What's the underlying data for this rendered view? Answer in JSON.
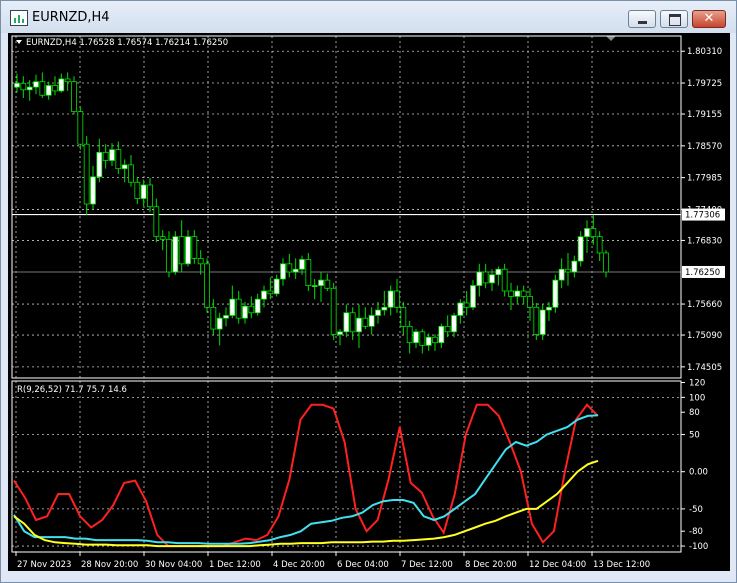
{
  "window": {
    "title": "EURNZD,H4",
    "icon": "chart-window-icon",
    "buttons": {
      "minimize": "minimize-icon",
      "maximize": "maximize-icon",
      "close": "close-icon"
    }
  },
  "chart_info": "EURNZD,H4  1.76528 1.76574 1.76214 1.76250",
  "colors": {
    "background": "#000000",
    "grid": "#c8c8c8",
    "bull_candle": "#ffffff",
    "bear_candle": "#000000",
    "candle_wick": "#00e000",
    "price_line": "#c0c0c0",
    "indicator_red": "#ff2020",
    "indicator_cyan": "#40e0f0",
    "indicator_yellow": "#ffff20"
  },
  "chart_data": [
    {
      "type": "candlestick",
      "title": "EURNZD,H4",
      "ohlc_readout": {
        "open": 1.76528,
        "high": 1.76574,
        "low": 1.76214,
        "close": 1.7625
      },
      "ylim": [
        1.743,
        1.8059
      ],
      "y_ticks": [
        "1.80310",
        "1.79725",
        "1.79155",
        "1.78570",
        "1.77985",
        "1.77400",
        "1.76830",
        "1.75660",
        "1.75090",
        "1.74505"
      ],
      "highlight_labels": [
        "1.77306",
        "1.76250"
      ],
      "horizontal_lines": [
        {
          "label": "1.77306",
          "value": 1.77306,
          "color": "#ffffff"
        },
        {
          "label": "1.76250",
          "value": 1.7625,
          "color": "#a0a0a0"
        }
      ],
      "candles": [
        [
          1.7965,
          1.799,
          1.7955,
          1.7972
        ],
        [
          1.7972,
          1.7985,
          1.7945,
          1.796
        ],
        [
          1.796,
          1.7978,
          1.794,
          1.7965
        ],
        [
          1.7965,
          1.7988,
          1.7952,
          1.7975
        ],
        [
          1.7975,
          1.7992,
          1.7945,
          1.795
        ],
        [
          1.795,
          1.7975,
          1.7942,
          1.7968
        ],
        [
          1.7968,
          1.7985,
          1.795,
          1.7958
        ],
        [
          1.7958,
          1.799,
          1.7955,
          1.798
        ],
        [
          1.798,
          1.7992,
          1.7958,
          1.7975
        ],
        [
          1.7975,
          1.7985,
          1.7915,
          1.792
        ],
        [
          1.792,
          1.793,
          1.785,
          1.786
        ],
        [
          1.786,
          1.7875,
          1.773,
          1.775
        ],
        [
          1.775,
          1.782,
          1.774,
          1.78
        ],
        [
          1.78,
          1.787,
          1.779,
          1.7845
        ],
        [
          1.7845,
          1.786,
          1.7815,
          1.783
        ],
        [
          1.783,
          1.7862,
          1.782,
          1.785
        ],
        [
          1.785,
          1.7865,
          1.7805,
          1.7815
        ],
        [
          1.7815,
          1.7832,
          1.779,
          1.7822
        ],
        [
          1.7822,
          1.784,
          1.7782,
          1.779
        ],
        [
          1.779,
          1.78,
          1.775,
          1.776
        ],
        [
          1.776,
          1.7795,
          1.7745,
          1.7785
        ],
        [
          1.7785,
          1.7798,
          1.7735,
          1.7745
        ],
        [
          1.7745,
          1.776,
          1.768,
          1.769
        ],
        [
          1.769,
          1.7702,
          1.7665,
          1.7685
        ],
        [
          1.7685,
          1.77,
          1.7615,
          1.7625
        ],
        [
          1.7625,
          1.77,
          1.762,
          1.769
        ],
        [
          1.769,
          1.772,
          1.7625,
          1.764
        ],
        [
          1.764,
          1.7702,
          1.7635,
          1.769
        ],
        [
          1.769,
          1.7702,
          1.764,
          1.765
        ],
        [
          1.765,
          1.7665,
          1.762,
          1.764
        ],
        [
          1.764,
          1.765,
          1.755,
          1.756
        ],
        [
          1.756,
          1.7575,
          1.751,
          1.752
        ],
        [
          1.752,
          1.755,
          1.749,
          1.754
        ],
        [
          1.754,
          1.756,
          1.7525,
          1.7545
        ],
        [
          1.7545,
          1.76,
          1.754,
          1.7575
        ],
        [
          1.7575,
          1.759,
          1.753,
          1.754
        ],
        [
          1.754,
          1.757,
          1.753,
          1.7562
        ],
        [
          1.7562,
          1.758,
          1.754,
          1.755
        ],
        [
          1.755,
          1.7585,
          1.7545,
          1.7575
        ],
        [
          1.7575,
          1.76,
          1.756,
          1.759
        ],
        [
          1.759,
          1.7615,
          1.7575,
          1.7585
        ],
        [
          1.7585,
          1.762,
          1.758,
          1.7612
        ],
        [
          1.7612,
          1.765,
          1.76,
          1.764
        ],
        [
          1.764,
          1.7658,
          1.7615,
          1.7625
        ],
        [
          1.7625,
          1.765,
          1.7612,
          1.763
        ],
        [
          1.763,
          1.7655,
          1.762,
          1.7648
        ],
        [
          1.7648,
          1.766,
          1.759,
          1.76
        ],
        [
          1.76,
          1.7612,
          1.7575,
          1.76
        ],
        [
          1.76,
          1.7625,
          1.757,
          1.761
        ],
        [
          1.761,
          1.7622,
          1.759,
          1.7595
        ],
        [
          1.7595,
          1.7605,
          1.75,
          1.751
        ],
        [
          1.751,
          1.752,
          1.749,
          1.7515
        ],
        [
          1.7515,
          1.7565,
          1.7505,
          1.755
        ],
        [
          1.755,
          1.756,
          1.75,
          1.7515
        ],
        [
          1.7515,
          1.7565,
          1.7485,
          1.754
        ],
        [
          1.754,
          1.756,
          1.752,
          1.7525
        ],
        [
          1.7525,
          1.756,
          1.751,
          1.7545
        ],
        [
          1.7545,
          1.757,
          1.753,
          1.7555
        ],
        [
          1.7555,
          1.759,
          1.7545,
          1.756
        ],
        [
          1.756,
          1.76,
          1.7545,
          1.759
        ],
        [
          1.759,
          1.7612,
          1.755,
          1.756
        ],
        [
          1.756,
          1.757,
          1.751,
          1.7525
        ],
        [
          1.7525,
          1.7535,
          1.7475,
          1.7495
        ],
        [
          1.7495,
          1.752,
          1.7485,
          1.7515
        ],
        [
          1.7515,
          1.752,
          1.7475,
          1.749
        ],
        [
          1.749,
          1.7512,
          1.748,
          1.7505
        ],
        [
          1.7505,
          1.751,
          1.748,
          1.7495
        ],
        [
          1.7495,
          1.753,
          1.7485,
          1.7525
        ],
        [
          1.7525,
          1.7545,
          1.7505,
          1.7515
        ],
        [
          1.7515,
          1.755,
          1.7505,
          1.7545
        ],
        [
          1.7545,
          1.7575,
          1.753,
          1.7568
        ],
        [
          1.7568,
          1.759,
          1.7545,
          1.756
        ],
        [
          1.756,
          1.761,
          1.7555,
          1.76
        ],
        [
          1.76,
          1.764,
          1.758,
          1.7625
        ],
        [
          1.7625,
          1.764,
          1.7595,
          1.7605
        ],
        [
          1.7605,
          1.763,
          1.759,
          1.762
        ],
        [
          1.762,
          1.7635,
          1.76,
          1.763
        ],
        [
          1.763,
          1.764,
          1.758,
          1.759
        ],
        [
          1.759,
          1.7605,
          1.7555,
          1.758
        ],
        [
          1.758,
          1.76,
          1.7565,
          1.759
        ],
        [
          1.759,
          1.76,
          1.7565,
          1.758
        ],
        [
          1.758,
          1.7595,
          1.7535,
          1.756
        ],
        [
          1.756,
          1.7568,
          1.75,
          1.751
        ],
        [
          1.751,
          1.7565,
          1.75,
          1.7555
        ],
        [
          1.7555,
          1.757,
          1.7535,
          1.756
        ],
        [
          1.756,
          1.762,
          1.755,
          1.761
        ],
        [
          1.761,
          1.765,
          1.7595,
          1.763
        ],
        [
          1.763,
          1.766,
          1.76,
          1.7625
        ],
        [
          1.7625,
          1.7655,
          1.7615,
          1.7645
        ],
        [
          1.7645,
          1.77,
          1.7635,
          1.769
        ],
        [
          1.769,
          1.772,
          1.766,
          1.7705
        ],
        [
          1.7705,
          1.773,
          1.7675,
          1.769
        ],
        [
          1.769,
          1.77,
          1.7645,
          1.766
        ],
        [
          1.766,
          1.7665,
          1.7615,
          1.7625
        ]
      ],
      "x_labels": [
        "27 Nov 2023",
        "28 Nov 20:00",
        "30 Nov 04:00",
        "1 Dec 12:00",
        "4 Dec 20:00",
        "6 Dec 04:00",
        "7 Dec 12:00",
        "8 Dec 20:00",
        "12 Dec 04:00",
        "13 Dec 12:00"
      ],
      "grid": true
    },
    {
      "type": "line",
      "title": "R(9,26,52) 71.7 75.7 14.6",
      "ylim": [
        -108,
        122
      ],
      "y_ticks": [
        "120",
        "100",
        "80",
        "50",
        "0.00",
        "-50",
        "-80",
        "-100"
      ],
      "series": [
        {
          "color": "#ff2020",
          "values": [
            -12,
            -35,
            -65,
            -60,
            -30,
            -30,
            -60,
            -75,
            -65,
            -45,
            -15,
            -12,
            -40,
            -85,
            -100,
            -100,
            -100,
            -100,
            -100,
            -100,
            -95,
            -90,
            -92,
            -85,
            -60,
            -10,
            70,
            90,
            90,
            85,
            40,
            -50,
            -80,
            -65,
            -10,
            60,
            -15,
            -28,
            -60,
            -82,
            -30,
            50,
            90,
            90,
            75,
            40,
            0,
            -70,
            -95,
            -80,
            0,
            70,
            90,
            75
          ],
          "last": 71.7
        },
        {
          "color": "#40e0f0",
          "values": [
            -58,
            -80,
            -88,
            -88,
            -88,
            -88,
            -90,
            -90,
            -92,
            -92,
            -92,
            -92,
            -92,
            -93,
            -95,
            -95,
            -96,
            -96,
            -96,
            -97,
            -97,
            -97,
            -97,
            -96,
            -94,
            -92,
            -88,
            -85,
            -80,
            -70,
            -68,
            -66,
            -62,
            -60,
            -55,
            -45,
            -40,
            -38,
            -38,
            -42,
            -60,
            -65,
            -60,
            -50,
            -40,
            -30,
            -10,
            10,
            30,
            40,
            35,
            40,
            50,
            55,
            60,
            70,
            75,
            76
          ],
          "last": 75.7
        },
        {
          "color": "#ffff20",
          "values": [
            -60,
            -70,
            -85,
            -92,
            -95,
            -96,
            -97,
            -98,
            -98,
            -98,
            -99,
            -99,
            -99,
            -99,
            -100,
            -100,
            -100,
            -100,
            -100,
            -100,
            -100,
            -100,
            -100,
            -100,
            -99,
            -98,
            -97,
            -97,
            -96,
            -96,
            -96,
            -95,
            -95,
            -95,
            -95,
            -94,
            -94,
            -93,
            -93,
            -92,
            -91,
            -90,
            -88,
            -85,
            -80,
            -75,
            -70,
            -66,
            -60,
            -55,
            -50,
            -50,
            -40,
            -30,
            -15,
            0,
            10,
            14.6
          ],
          "last": 14.6
        }
      ],
      "grid": true
    }
  ]
}
